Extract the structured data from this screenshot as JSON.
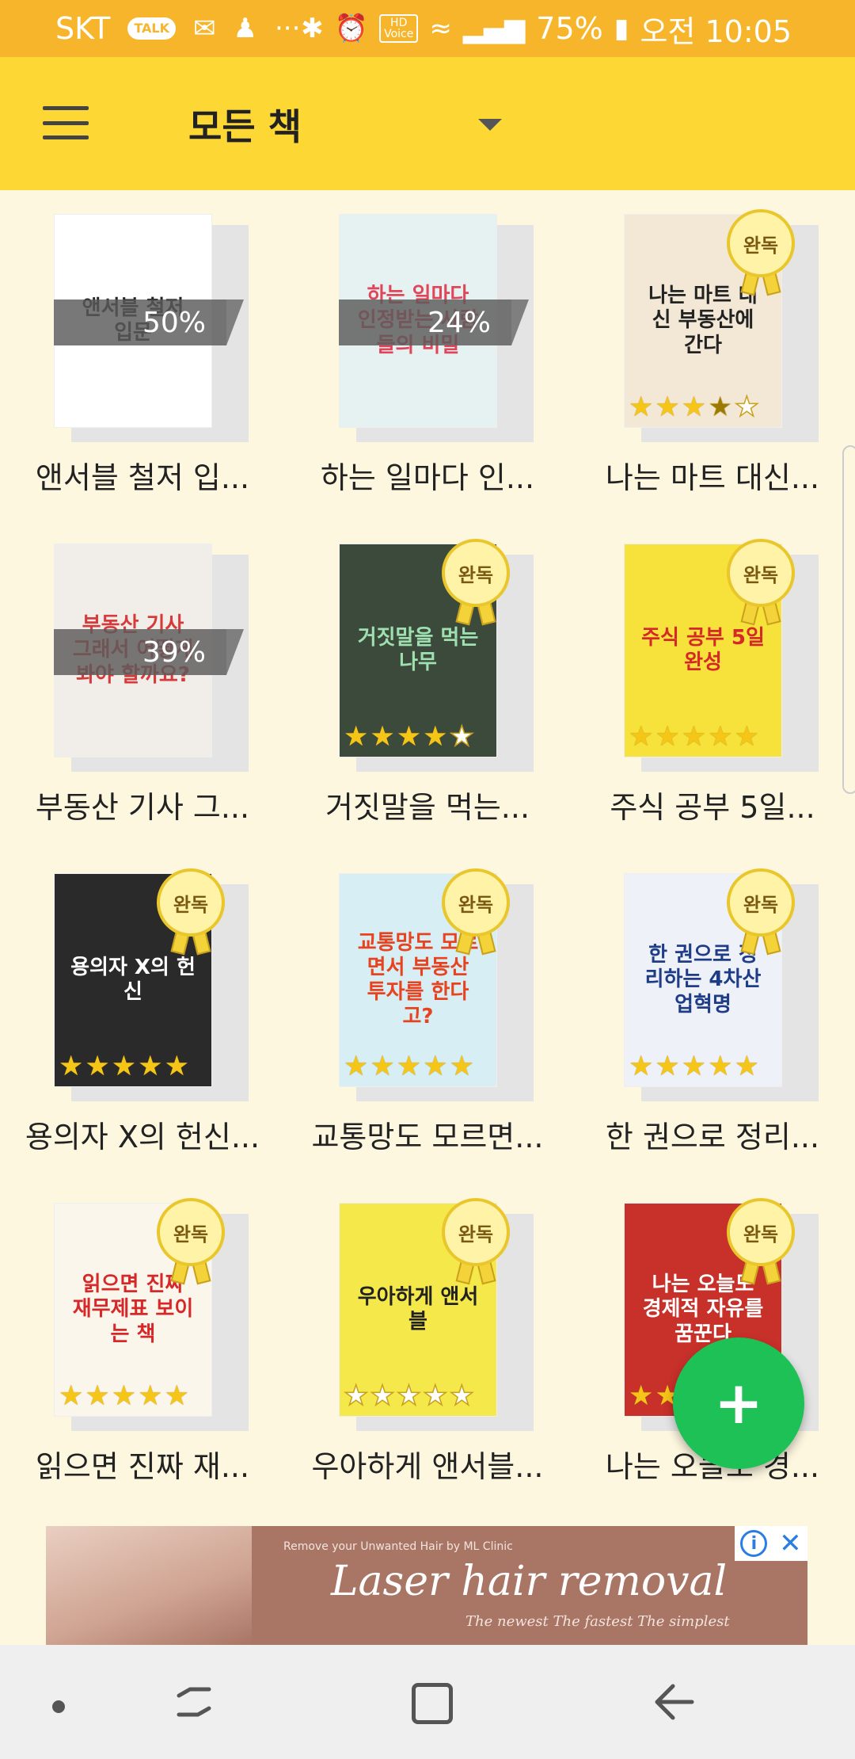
{
  "status_bar": {
    "carrier": "SKT",
    "talk": "TALK",
    "more": "···",
    "hd": "HD",
    "voice": "Voice",
    "battery": "75%",
    "time": "오전 10:05"
  },
  "toolbar": {
    "title": "모든 책"
  },
  "books": [
    {
      "title": "앤서블 철저 입...",
      "cover_text": "앤서블 철저 입문",
      "progress": "50%",
      "completed": false,
      "rating": null,
      "cover_color": "#FFFFFF",
      "text_color": "#222222"
    },
    {
      "title": "하는 일마다 인...",
      "cover_text": "하는 일마다 인정받는 사람들의 비밀",
      "progress": "24%",
      "completed": false,
      "rating": null,
      "cover_color": "#E6F1F2",
      "text_color": "#E0455A"
    },
    {
      "title": "나는 마트 대신...",
      "cover_text": "나는 마트 대신 부동산에 간다",
      "progress": null,
      "completed": true,
      "rating": 3.5,
      "cover_color": "#F3E7D6",
      "text_color": "#222222"
    },
    {
      "title": "부동산 기사 그...",
      "cover_text": "부동산 기사 그래서 어떻게 봐야 할까요?",
      "progress": "39%",
      "completed": false,
      "rating": null,
      "cover_color": "#F1EEEA",
      "text_color": "#D63A3A"
    },
    {
      "title": "거짓말을 먹는...",
      "cover_text": "거짓말을 먹는 나무",
      "progress": null,
      "completed": true,
      "rating": 4,
      "cover_color": "#3C4A3C",
      "text_color": "#9FE0B0"
    },
    {
      "title": "주식 공부 5일...",
      "cover_text": "주식 공부 5일 완성",
      "progress": null,
      "completed": true,
      "rating": 5,
      "cover_color": "#F6E23A",
      "text_color": "#D62828"
    },
    {
      "title": "용의자 X의 헌신...",
      "cover_text": "용의자 X의 헌신",
      "progress": null,
      "completed": true,
      "rating": 5,
      "cover_color": "#2A2A2A",
      "text_color": "#FFFFFF"
    },
    {
      "title": "교통망도 모르면...",
      "cover_text": "교통망도 모르면서 부동산 투자를 한다고?",
      "progress": null,
      "completed": true,
      "rating": 5,
      "cover_color": "#D6EEF4",
      "text_color": "#E8421E"
    },
    {
      "title": "한 권으로 정리...",
      "cover_text": "한 권으로 정리하는 4차산업혁명",
      "progress": null,
      "completed": true,
      "rating": 5,
      "cover_color": "#EEF2F8",
      "text_color": "#1F3C88"
    },
    {
      "title": "읽으면 진짜 재...",
      "cover_text": "읽으면 진짜 재무제표 보이는 책",
      "progress": null,
      "completed": true,
      "rating": 5,
      "cover_color": "#FBF6EC",
      "text_color": "#D62828"
    },
    {
      "title": "우아하게 앤서블...",
      "cover_text": "우아하게 앤서블",
      "progress": null,
      "completed": true,
      "rating": 0,
      "cover_color": "#F4E84A",
      "text_color": "#222222"
    },
    {
      "title": "나는 오늘도 경...",
      "cover_text": "나는 오늘도 경제적 자유를 꿈꾼다",
      "progress": null,
      "completed": true,
      "rating": 2,
      "cover_color": "#C8302A",
      "text_color": "#FFFFFF"
    }
  ],
  "completed_label": "완독",
  "fab": {
    "label": "+"
  },
  "ad": {
    "small_text": "Remove your Unwanted Hair by ML Clinic",
    "headline": "Laser hair removal",
    "sub": "The newest   The fastest   The simplest",
    "info": "i",
    "close": "✕"
  },
  "colors": {
    "status_bar": "#F7B52C",
    "toolbar": "#FDD835",
    "background": "#FDF7E0",
    "fab": "#1DC156",
    "star": "#F5C518"
  }
}
